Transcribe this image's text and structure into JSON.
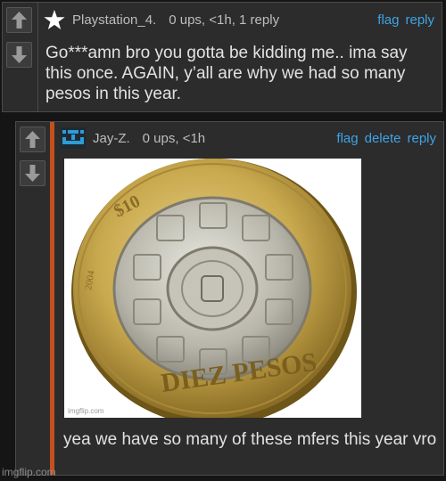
{
  "comments": [
    {
      "username": "Playstation_4.",
      "meta": "0 ups, <1h, 1 reply",
      "actions": [
        "flag",
        "reply"
      ],
      "text": "Go***amn bro you gotta be kidding me.. ima say this once. AGAIN, y’all are why we had so many pesos in this year.",
      "avatar_icon": "star-icon"
    },
    {
      "username": "Jay-Z.",
      "meta": "0 ups, <1h",
      "actions": [
        "flag",
        "delete",
        "reply"
      ],
      "image": {
        "coin_text": "DIEZ PESOS",
        "denomination": "$10",
        "year": "2004",
        "watermark": "imgflip.com"
      },
      "text": "yea we have so many of these mfers this year vro",
      "avatar_icon": "pixel-avatar-icon",
      "accent_color": "#c4501f"
    }
  ],
  "watermark": "imgflip.com",
  "colors": {
    "link": "#3fa3e6",
    "background": "#151515",
    "panel": "#2c2c2c"
  }
}
